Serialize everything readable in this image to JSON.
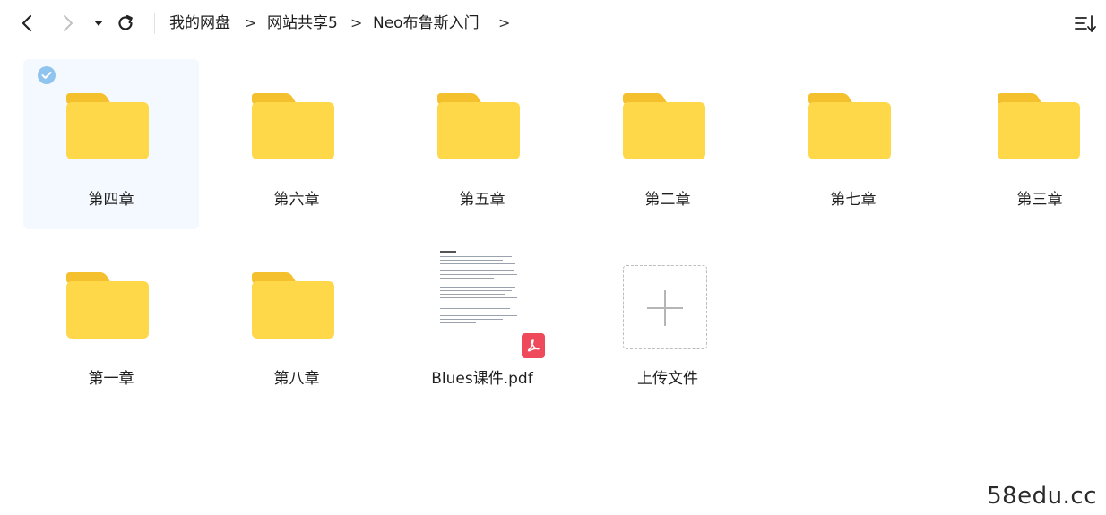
{
  "toolbar": {
    "back_icon": "chevron-left-icon",
    "forward_icon": "chevron-right-icon",
    "history_icon": "caret-down-icon",
    "refresh_icon": "refresh-icon",
    "sort_icon": "sort-list-icon",
    "separator": ">",
    "breadcrumb": [
      "我的网盘",
      "网站共享5",
      "Neo布鲁斯入门"
    ]
  },
  "items": [
    {
      "name": "第四章",
      "type": "folder",
      "selected": true
    },
    {
      "name": "第六章",
      "type": "folder"
    },
    {
      "name": "第五章",
      "type": "folder"
    },
    {
      "name": "第二章",
      "type": "folder"
    },
    {
      "name": "第七章",
      "type": "folder"
    },
    {
      "name": "第三章",
      "type": "folder"
    },
    {
      "name": "第一章",
      "type": "folder"
    },
    {
      "name": "第八章",
      "type": "folder"
    },
    {
      "name": "Blues课件.pdf",
      "type": "pdf"
    },
    {
      "name": "上传文件",
      "type": "upload"
    }
  ],
  "colors": {
    "folder_front": "#ffd84a",
    "folder_back": "#f5c02e",
    "selected_bg": "#f4f9ff",
    "check": "#8fc4ef",
    "pdf_badge": "#ef4a5b"
  },
  "watermark": "58edu.cc"
}
